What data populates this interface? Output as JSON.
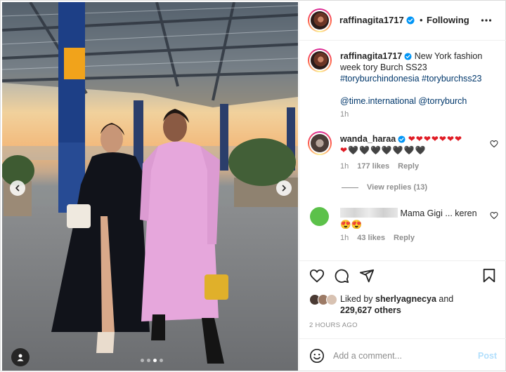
{
  "post": {
    "username": "raffinagita1717",
    "separator": "•",
    "follow_status": "Following",
    "caption": {
      "username": "raffinagita1717",
      "text": "New York fashion week tory Burch SS23",
      "hashtags": "#toryburchindonesia #toryburchss23",
      "mentions": "@time.international @torryburch",
      "time": "1h"
    },
    "comments": [
      {
        "username": "wanda_haraa",
        "hearts_red": "❤❤❤❤❤❤❤",
        "hearts_black": "🖤🖤🖤🖤🖤🖤🖤",
        "time": "1h",
        "likes": "177 likes",
        "reply": "Reply",
        "view_replies": "View replies (13)"
      },
      {
        "username_redacted": true,
        "text": "Mama Gigi ... keren",
        "emoji": "😍😍",
        "time": "1h",
        "likes": "43 likes",
        "reply": "Reply"
      }
    ],
    "liked_by_prefix": "Liked by ",
    "liked_by_user": "sherlyagnecya",
    "liked_by_and": " and",
    "liked_by_count": "229,627 others",
    "time_ago": "2 HOURS AGO",
    "add_comment_placeholder": "Add a comment...",
    "post_label": "Post"
  },
  "carousel": {
    "dots_total": 4,
    "active_dot": 2
  },
  "colors": {
    "verified_blue": "#0095f6",
    "link_blue": "#00376b",
    "muted": "#8e8e8e",
    "post_disabled": "#b2dffc"
  },
  "icons": [
    "chevron-left-icon",
    "chevron-right-icon",
    "user-tag-icon",
    "more-icon",
    "verified-icon",
    "heart-icon",
    "comment-icon",
    "share-icon",
    "bookmark-icon",
    "emoji-icon"
  ]
}
